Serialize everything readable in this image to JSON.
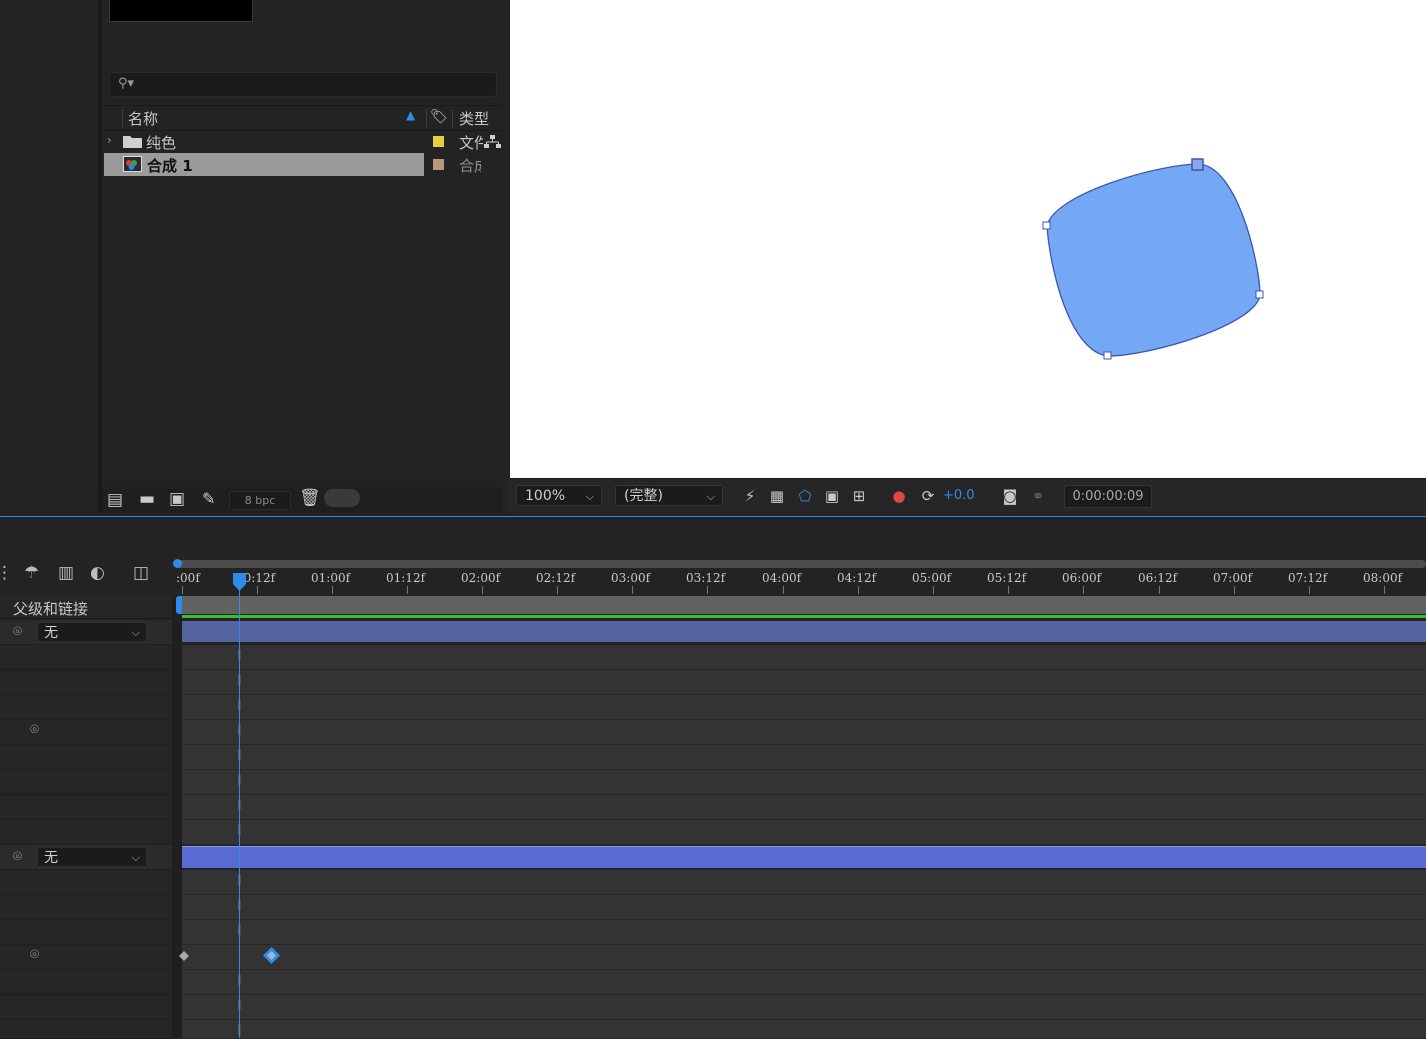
{
  "project": {
    "search_placeholder": "",
    "columns": {
      "name": "名称",
      "type": "类型"
    },
    "items": [
      {
        "name": "纯色",
        "label_color": "#e6cf3a",
        "type": "文件"
      },
      {
        "name": "合成 1",
        "label_color": "#b39a7a",
        "type": "合成"
      }
    ],
    "bpc": "8 bpc"
  },
  "viewer": {
    "magnification": "100%",
    "resolution": "(完整)",
    "exposure": "+0.0",
    "timecode": "0:00:00:09"
  },
  "timeline": {
    "parent_column_label": "父级和链接",
    "ruler_labels": [
      ":00f",
      "00:12f",
      "01:00f",
      "01:12f",
      "02:00f",
      "02:12f",
      "03:00f",
      "03:12f",
      "04:00f",
      "04:12f",
      "05:00f",
      "05:12f",
      "06:00f",
      "06:12f",
      "07:00f",
      "07:12f",
      "08:00f"
    ],
    "layers": [
      {
        "parent": "无"
      },
      {
        "parent": "无"
      }
    ]
  },
  "colors": {
    "accent": "#2d8ceb",
    "shape_fill": "#74a7f4",
    "shape_stroke": "#3b57b0"
  }
}
